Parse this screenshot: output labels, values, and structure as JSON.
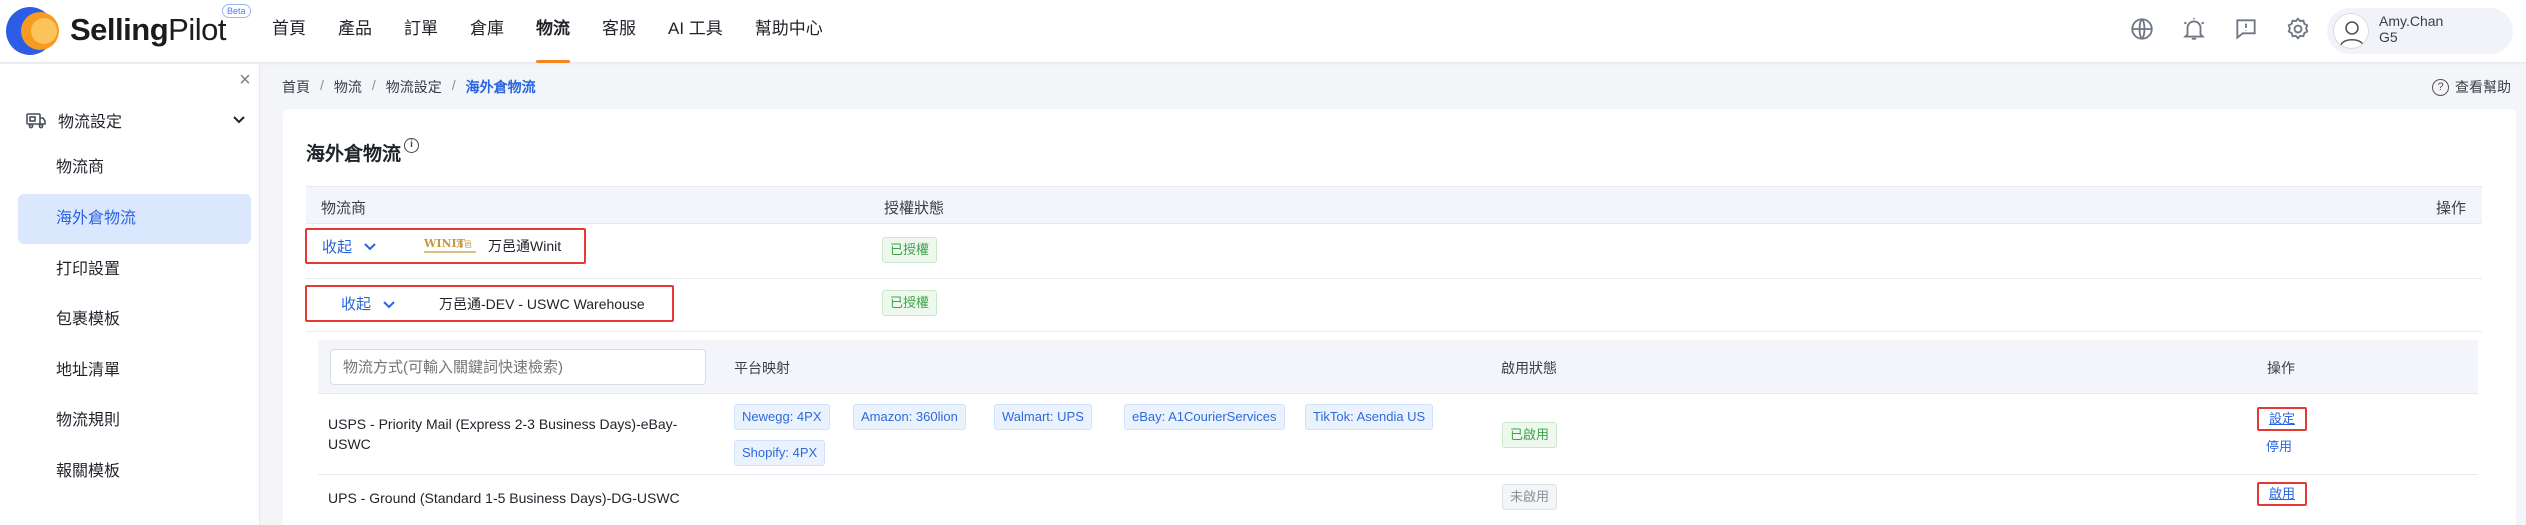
{
  "app": {
    "brand_bold": "Selling",
    "brand_light": "Pilot",
    "beta": "Beta"
  },
  "nav": {
    "items": [
      "首頁",
      "產品",
      "訂單",
      "倉庫",
      "物流",
      "客服",
      "AI 工具",
      "幫助中心"
    ],
    "active": "物流"
  },
  "header_icons": [
    "globe-icon",
    "bell-icon",
    "message-icon",
    "gear-icon"
  ],
  "user": {
    "name": "Amy.Chan",
    "org": "G5"
  },
  "sidebar": {
    "group_label": "物流設定",
    "items": [
      "物流商",
      "海外倉物流",
      "打印設置",
      "包裹模板",
      "地址清單",
      "物流規則",
      "報關模板"
    ],
    "active": "海外倉物流"
  },
  "breadcrumb": [
    "首頁",
    "物流",
    "物流設定",
    "海外倉物流"
  ],
  "help_label": "查看幫助",
  "page": {
    "title": "海外倉物流",
    "columns": {
      "carrier": "物流商",
      "auth": "授權狀態",
      "ops": "操作"
    },
    "carriers": [
      {
        "toggle": "收起",
        "logo_text": "WINIT 万邑通",
        "name": "万邑通Winit",
        "auth": "已授權"
      },
      {
        "toggle": "收起",
        "name": "万邑通-DEV - USWC Warehouse",
        "auth": "已授權"
      }
    ]
  },
  "methods": {
    "search_placeholder": "物流方式(可輸入關鍵詞快速檢索)",
    "columns": {
      "mapping": "平台映射",
      "status": "啟用狀態",
      "ops": "操作"
    },
    "rows": [
      {
        "name_line1": "USPS - Priority Mail (Express 2-3 Business Days)-eBay-",
        "name_line2": "USWC",
        "mappings": [
          "Newegg: 4PX",
          "Amazon: 360lion",
          "Walmart: UPS",
          "eBay: A1CourierServices",
          "TikTok: Asendia US",
          "Shopify: 4PX"
        ],
        "status": "已啟用",
        "op_primary": "設定",
        "op_secondary": "停用"
      },
      {
        "name_line1": "UPS - Ground (Standard 1-5 Business Days)-DG-USWC",
        "mappings": [],
        "status": "未啟用",
        "op_primary": "啟用"
      }
    ]
  },
  "colors": {
    "accent": "#2a64e0",
    "nav_underline": "#f7841f",
    "highlight_border": "#e53935"
  }
}
